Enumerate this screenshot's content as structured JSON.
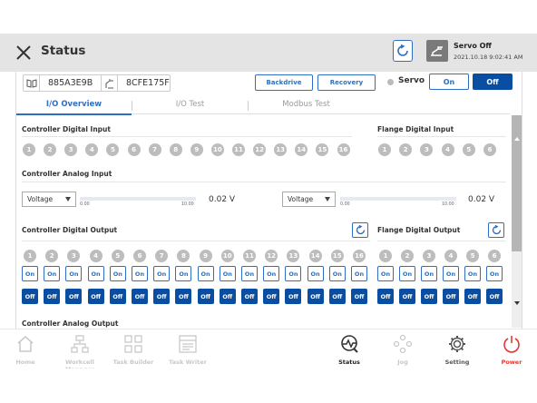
{
  "header": {
    "title": "Status",
    "servo_status": "Servo Off",
    "datetime": "2021.10.18 9:02:41 AM"
  },
  "ids": {
    "robot_id": "885A3E9B",
    "controller_id": "8CFE175F"
  },
  "toolbar": {
    "backdrive": "Backdrive",
    "recovery": "Recovery",
    "servo_label": "Servo",
    "on": "On",
    "off": "Off"
  },
  "tabs": [
    {
      "label": "I/O Overview",
      "active": true
    },
    {
      "label": "I/O Test"
    },
    {
      "label": "Modbus Test"
    }
  ],
  "sections": {
    "controller_digital_input": "Controller Digital Input",
    "flange_digital_input": "Flange Digital Input",
    "controller_analog_input": "Controller Analog Input",
    "controller_digital_output": "Controller Digital Output",
    "flange_digital_output": "Flange Digital Output",
    "controller_analog_output": "Controller Analog Output"
  },
  "controller_digital_input": [
    "1",
    "2",
    "3",
    "4",
    "5",
    "6",
    "7",
    "8",
    "9",
    "10",
    "11",
    "12",
    "13",
    "14",
    "15",
    "16"
  ],
  "flange_digital_input": [
    "1",
    "2",
    "3",
    "4",
    "5",
    "6"
  ],
  "analog_inputs": [
    {
      "mode": "Voltage",
      "min": "0.00",
      "max": "10.00",
      "value": "0.02 V"
    },
    {
      "mode": "Voltage",
      "min": "0.00",
      "max": "10.00",
      "value": "0.02 V"
    }
  ],
  "controller_digital_output": [
    "1",
    "2",
    "3",
    "4",
    "5",
    "6",
    "7",
    "8",
    "9",
    "10",
    "11",
    "12",
    "13",
    "14",
    "15",
    "16"
  ],
  "flange_digital_output": [
    "1",
    "2",
    "3",
    "4",
    "5",
    "6"
  ],
  "output_buttons": {
    "on": "On",
    "off": "Off"
  },
  "nav": [
    {
      "label": "Home",
      "icon": "home-icon",
      "active": false
    },
    {
      "label": "Workcell Manager",
      "icon": "workcell-icon",
      "active": false
    },
    {
      "label": "Task Builder",
      "icon": "task-builder-icon",
      "active": false
    },
    {
      "label": "Task Writer",
      "icon": "task-writer-icon",
      "active": false
    },
    {
      "label": "Status",
      "icon": "status-icon",
      "active": true
    },
    {
      "label": "Jog",
      "icon": "jog-icon",
      "active": false
    },
    {
      "label": "Setting",
      "icon": "gear-icon",
      "active": false
    },
    {
      "label": "Power",
      "icon": "power-icon",
      "active": false
    }
  ],
  "colors": {
    "accent": "#2f6fc1",
    "off_button": "#0a4ea3",
    "power": "#e53935",
    "header_bg": "#e4e4e4"
  }
}
